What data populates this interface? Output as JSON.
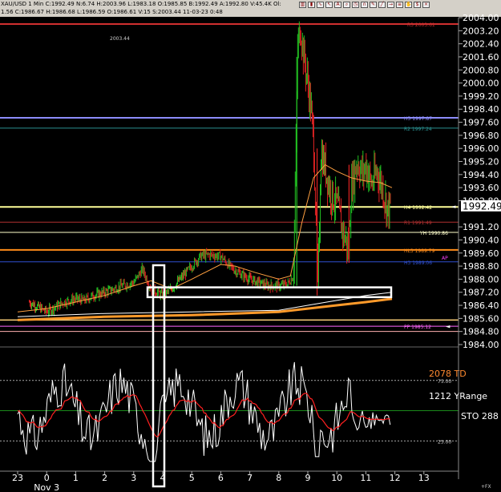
{
  "toolbar": {
    "quote_text": "XAU/USD 1 Min  C:1992.49  N:6.74  H:2003.96  L:1983.18  O:1985.85  B:1992.49  A:1992.80  V:45.4K  Ol:",
    "icons": [
      "bar-chart-icon",
      "candle-icon",
      "line-chart-icon",
      "cursor-icon",
      "text-icon",
      "zoom-icon",
      "clock-icon",
      "magnet-icon",
      "pencil-icon",
      "trendline-icon",
      "arrow-icon",
      "fib-icon",
      "hand-icon",
      "dollar-icon",
      "close-icon"
    ]
  },
  "infobar": {
    "text": "1.56  C:1986.67  H:1986.68  L:1986.59  O:1986.61  V:15  S:2003.44  11-03-23  0:48"
  },
  "price_axis": {
    "ticks": [
      "2004.00",
      "2003.20",
      "2002.40",
      "2001.60",
      "2000.80",
      "2000.00",
      "1999.20",
      "1998.40",
      "1997.60",
      "1996.80",
      "1996.00",
      "1995.20",
      "1994.40",
      "1993.60",
      "1992.80",
      "1991.20",
      "1990.40",
      "1989.60",
      "1988.80",
      "1988.00",
      "1987.20",
      "1986.40",
      "1985.60",
      "1984.80",
      "1984.00"
    ],
    "last_price": "1992.49"
  },
  "time_axis": {
    "ticks": [
      "23",
      "0",
      "1",
      "2",
      "3",
      "4",
      "5",
      "6",
      "7",
      "8",
      "9",
      "10",
      "11",
      "12",
      "13"
    ],
    "date_label": "Nov 3"
  },
  "price_levels": [
    {
      "label": "R3 2003.61",
      "price": 2003.61,
      "color": "#d03030",
      "thick": true
    },
    {
      "label": "H5 1997.87",
      "price": 1997.87,
      "color": "#8c8cff",
      "thick": true
    },
    {
      "label": "R2 1997.24",
      "price": 1997.24,
      "color": "#2a9090",
      "thick": false
    },
    {
      "label": "H4 1992.42",
      "price": 1992.42,
      "color": "#ffff99",
      "thick": true
    },
    {
      "label": "R1 1991.49",
      "price": 1991.49,
      "color": "#b03030",
      "thick": false
    },
    {
      "label": "YH 1990.86",
      "price": 1990.86,
      "color": "#ffffcc",
      "thick": false
    },
    {
      "label": "HL3 1989.79",
      "price": 1989.79,
      "color": "#ff8c1a",
      "thick": true
    },
    {
      "label": "H3 1989.06",
      "price": 1989.06,
      "color": "#3050d0",
      "thick": false
    },
    {
      "label": "PP 1985.12",
      "price": 1985.12,
      "color": "#ff66ff",
      "thick": false
    }
  ],
  "annotations": {
    "top_price": "2003.44",
    "magenta_label": "AP"
  },
  "oscillator": {
    "td_label": "2078 TD",
    "yrange_label": "1212 YRange",
    "sto_label": "STO 288",
    "level_high": "75.00",
    "level_low": "25.00"
  },
  "corner_label": "+FX",
  "colors": {
    "candle_up": "#22c022",
    "candle_down": "#dd2222",
    "ma": "#ffa040",
    "osc_line": "#ffffff",
    "osc_signal": "#ff2020"
  },
  "chart_data": {
    "type": "candlestick",
    "symbol": "XAU/USD",
    "interval": "1 Min",
    "ylim": [
      1984.0,
      2004.0
    ],
    "x_ticks": [
      "23",
      "0",
      "1",
      "2",
      "3",
      "4",
      "5",
      "6",
      "7",
      "8",
      "9",
      "10",
      "11",
      "12",
      "13"
    ],
    "close_path": [
      {
        "x": -0.6,
        "y": 1986.6
      },
      {
        "x": -0.3,
        "y": 1986.3
      },
      {
        "x": 0.0,
        "y": 1986.0
      },
      {
        "x": 0.3,
        "y": 1986.3
      },
      {
        "x": 0.6,
        "y": 1986.6
      },
      {
        "x": 1.0,
        "y": 1986.8
      },
      {
        "x": 1.3,
        "y": 1986.7
      },
      {
        "x": 1.6,
        "y": 1987.0
      },
      {
        "x": 2.0,
        "y": 1987.2
      },
      {
        "x": 2.3,
        "y": 1987.4
      },
      {
        "x": 2.6,
        "y": 1987.6
      },
      {
        "x": 3.0,
        "y": 1987.8
      },
      {
        "x": 3.3,
        "y": 1988.6
      },
      {
        "x": 3.6,
        "y": 1987.4
      },
      {
        "x": 4.0,
        "y": 1987.0
      },
      {
        "x": 4.3,
        "y": 1987.4
      },
      {
        "x": 4.6,
        "y": 1988.0
      },
      {
        "x": 5.0,
        "y": 1988.8
      },
      {
        "x": 5.3,
        "y": 1989.4
      },
      {
        "x": 5.6,
        "y": 1989.5
      },
      {
        "x": 6.0,
        "y": 1989.4
      },
      {
        "x": 6.3,
        "y": 1988.8
      },
      {
        "x": 6.6,
        "y": 1988.4
      },
      {
        "x": 7.0,
        "y": 1988.0
      },
      {
        "x": 7.3,
        "y": 1987.8
      },
      {
        "x": 7.6,
        "y": 1987.6
      },
      {
        "x": 8.0,
        "y": 1987.6
      },
      {
        "x": 8.3,
        "y": 1987.7
      },
      {
        "x": 8.5,
        "y": 1988.2
      },
      {
        "x": 8.6,
        "y": 1996.5
      },
      {
        "x": 8.65,
        "y": 2002.2
      },
      {
        "x": 8.75,
        "y": 2003.4
      },
      {
        "x": 8.85,
        "y": 2001.8
      },
      {
        "x": 9.0,
        "y": 2000.0
      },
      {
        "x": 9.1,
        "y": 1998.6
      },
      {
        "x": 9.2,
        "y": 1996.4
      },
      {
        "x": 9.35,
        "y": 1987.2
      },
      {
        "x": 9.45,
        "y": 1995.8
      },
      {
        "x": 9.6,
        "y": 1994.8
      },
      {
        "x": 9.8,
        "y": 1993.2
      },
      {
        "x": 10.0,
        "y": 1992.6
      },
      {
        "x": 10.2,
        "y": 1991.0
      },
      {
        "x": 10.4,
        "y": 1989.8
      },
      {
        "x": 10.5,
        "y": 1993.6
      },
      {
        "x": 10.7,
        "y": 1995.2
      },
      {
        "x": 10.9,
        "y": 1994.4
      },
      {
        "x": 11.0,
        "y": 1995.0
      },
      {
        "x": 11.2,
        "y": 1993.8
      },
      {
        "x": 11.4,
        "y": 1994.6
      },
      {
        "x": 11.6,
        "y": 1993.4
      },
      {
        "x": 11.75,
        "y": 1992.2
      },
      {
        "x": 11.85,
        "y": 1992.49
      }
    ],
    "level_lines": [
      {
        "label": "R3",
        "value": 2003.61
      },
      {
        "label": "H5",
        "value": 1997.87
      },
      {
        "label": "R2",
        "value": 1997.24
      },
      {
        "label": "H4",
        "value": 1992.42
      },
      {
        "label": "R1",
        "value": 1991.49
      },
      {
        "label": "YH",
        "value": 1990.86
      },
      {
        "label": "HL3",
        "value": 1989.79
      },
      {
        "label": "H3",
        "value": 1989.06
      },
      {
        "label": "PP",
        "value": 1985.12
      }
    ],
    "last_price": 1992.49
  }
}
